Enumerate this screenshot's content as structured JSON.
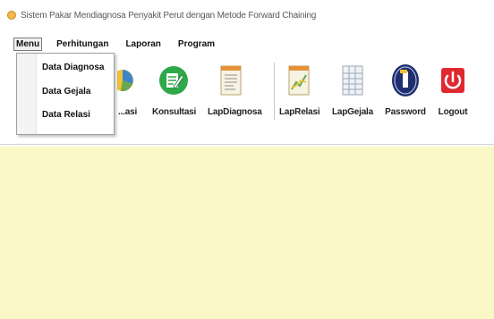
{
  "window": {
    "title": "Sistem Pakar Mendiagnosa Penyakit Perut dengan Metode Forward Chaining"
  },
  "menubar": {
    "items": [
      "Menu",
      "Perhitungan",
      "Laporan",
      "Program"
    ]
  },
  "dropdown": {
    "items": [
      "Data Diagnosa",
      "Data Gejala",
      "Data Relasi"
    ]
  },
  "toolbar": {
    "items": [
      {
        "label": "...asi",
        "icon": "pie-chart-icon"
      },
      {
        "label": "Konsultasi",
        "icon": "edit-document-icon"
      },
      {
        "label": "LapDiagnosa",
        "icon": "report-document-icon"
      },
      {
        "label": "LapRelasi",
        "icon": "chart-document-icon"
      },
      {
        "label": "LapGejala",
        "icon": "spreadsheet-icon"
      },
      {
        "label": "Password",
        "icon": "password-icon"
      },
      {
        "label": "Logout",
        "icon": "power-icon"
      }
    ]
  },
  "colors": {
    "workarea": "#fbf8c8",
    "green": "#2ea84a",
    "navy": "#1f2f6e",
    "red": "#e0282f"
  }
}
